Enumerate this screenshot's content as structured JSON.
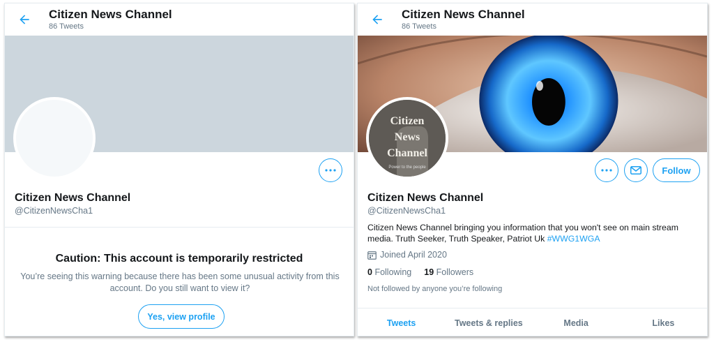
{
  "profile": {
    "title": "Citizen News Channel",
    "tweet_count": "86 Tweets",
    "name": "Citizen News Channel",
    "handle": "@CitizenNewsCha1"
  },
  "left": {
    "caution_title": "Caution: This account is temporarily restricted",
    "caution_text": "You’re seeing this warning because there has been some unusual activity from this account. Do you still want to view it?",
    "view_button": "Yes, view profile"
  },
  "right": {
    "follow_button": "Follow",
    "bio_text": "Citizen News Channel bringing you information that you won't see on main stream media. Truth Seeker, Truth Speaker, Patriot Uk ",
    "bio_hashtag": "#WWG1WGA",
    "joined": "Joined April 2020",
    "following_count": "0",
    "following_label": "Following",
    "followers_count": "19",
    "followers_label": "Followers",
    "not_followed": "Not followed by anyone you’re following",
    "avatar_text": {
      "line1": "Citizen",
      "line2": "News",
      "line3": "Channel",
      "tagline": "Power to the people"
    },
    "tabs": [
      "Tweets",
      "Tweets & replies",
      "Media",
      "Likes"
    ],
    "active_tab": "Tweets"
  },
  "colors": {
    "accent": "#1da1f2",
    "banner_placeholder": "#ccd6dd",
    "secondary_text": "#657786",
    "eye_iris": "#1e90ff"
  },
  "icons": [
    "back-arrow-icon",
    "more-icon",
    "message-icon",
    "calendar-icon"
  ]
}
